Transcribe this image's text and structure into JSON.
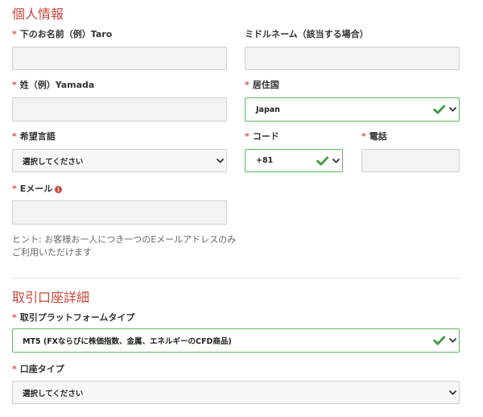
{
  "required_mark": "*",
  "personal": {
    "heading": "個人情報",
    "first_name": {
      "label": "下のお名前（例）Taro"
    },
    "middle_name": {
      "label": "ミドルネーム（該当する場合）"
    },
    "last_name": {
      "label": "姓（例）Yamada"
    },
    "country": {
      "label": "居住国",
      "selected": "Japan"
    },
    "language": {
      "label": "希望言語",
      "selected": "選択してください"
    },
    "code": {
      "label": "コード",
      "selected": "+81"
    },
    "phone": {
      "label": "電話"
    },
    "email": {
      "label": "Eメール"
    },
    "hint": {
      "line1": "ヒント: お客様お一人につき一つのEメールアドレスのみ",
      "line2": "ご利用いただけます"
    }
  },
  "account": {
    "heading": "取引口座詳細",
    "platform": {
      "label": "取引プラットフォームタイプ",
      "selected": "MT5 (FXならびに株価指数、金属、エネルギーのCFD商品)"
    },
    "account_type": {
      "label": "口座タイプ",
      "selected": "選択してください"
    }
  },
  "icons": {
    "valid_indicator": "check-icon",
    "dropdown": "chevron-down-icon",
    "email_info": "info-icon"
  },
  "colors": {
    "heading": "#c8463c",
    "required": "#d9534f",
    "label": "#333333",
    "hint": "#666666",
    "border": "#d0d0d0",
    "input_bg": "#f3f3f3",
    "select_bg": "#f7f7f7",
    "valid": "#5cb85c",
    "check": "#3d9b3d",
    "divider": "#e6e6e6",
    "info": "#c9473d",
    "value": "#222222",
    "chevron": "#333333"
  }
}
